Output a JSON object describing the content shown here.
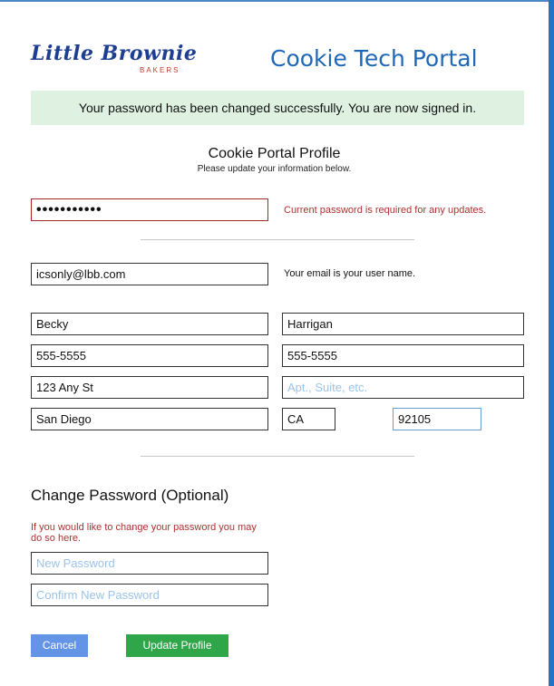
{
  "brand": {
    "name": "Little Brownie",
    "subname": "BAKERS"
  },
  "portal_title": "Cookie Tech Portal",
  "success_message": "Your password has been changed successfully. You are now signed in.",
  "profile": {
    "title": "Cookie Portal Profile",
    "subtitle": "Please update your information below."
  },
  "current_password": {
    "masked_value": "•••••••••••",
    "error": "Current password is required for any updates."
  },
  "email": {
    "value": "icsonly@lbb.com",
    "note": "Your email is your user name."
  },
  "first_name": "Becky",
  "last_name": "Harrigan",
  "phone_1": "555-5555",
  "phone_2": "555-5555",
  "address_1": "123 Any St",
  "address_2": {
    "value": "",
    "placeholder": "Apt., Suite, etc."
  },
  "city": "San Diego",
  "state": "CA",
  "zip": "92105",
  "change_password": {
    "title": "Change Password (Optional)",
    "note": "If you would like to change your password you may do so here.",
    "new_placeholder": "New Password",
    "confirm_placeholder": "Confirm New Password"
  },
  "buttons": {
    "cancel": "Cancel",
    "update": "Update Profile"
  },
  "colors": {
    "accent_blue": "#1f67b7",
    "success_bg": "#dff2e1",
    "error_red": "#b03030",
    "cancel_blue": "#6494e6",
    "update_green": "#2fa64a"
  }
}
